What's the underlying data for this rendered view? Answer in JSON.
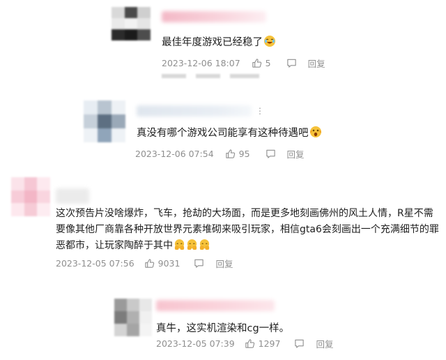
{
  "comments": [
    {
      "text": "最佳年度游戏已经稳了",
      "timestamp": "2023-12-06 18:07",
      "likes": "5",
      "reply_label": "回复"
    },
    {
      "text": "真没有哪个游戏公司能享有这种待遇吧",
      "timestamp": "2023-12-06 07:54",
      "likes": "95",
      "reply_label": "回复"
    },
    {
      "text_lines": [
        "这次预告片没啥爆炸，飞车，抢劫的大场面，而是更多地刻画佛州的风土人情，R星不需",
        "要像其他厂商靠各种开放世界元素堆砌来吸引玩家，相信gta6会刻画出一个充满细节的罪",
        "恶都市，让玩家陶醉于其中"
      ],
      "timestamp": "2023-12-05 07:56",
      "likes": "9031",
      "reply_label": "回复"
    },
    {
      "text": "真牛，这实机渲染和cg一样。",
      "timestamp": "2023-12-05 07:39",
      "likes": "1297",
      "reply_label": "回复"
    }
  ],
  "icons": {
    "like": "thumbs-up-icon",
    "comment": "comment-bubble-icon",
    "more": "more-dots-icon",
    "emoji_laugh": "laughing-crying-emoji",
    "emoji_shock": "shocked-emoji",
    "emoji_bow": "bowing-hands-emoji"
  },
  "colors": {
    "text": "#1e1e1e",
    "meta": "#8f8f8f",
    "emoji": "#f6c23a"
  }
}
